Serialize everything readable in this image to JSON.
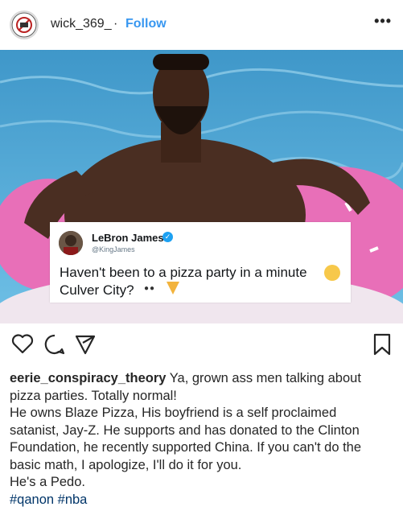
{
  "header": {
    "username": "wick_369_",
    "separator": "·",
    "follow_label": "Follow",
    "more_label": "•••"
  },
  "tweet": {
    "name": "LeBron James",
    "handle": "@KingJames",
    "line1": "Haven't been to a pizza party in a minute",
    "line2": "Culver City?"
  },
  "actions": {
    "like_icon": "heart-icon",
    "comment_icon": "comment-icon",
    "share_icon": "share-icon",
    "save_icon": "bookmark-icon"
  },
  "caption": {
    "user": "eerie_conspiracy_theory",
    "line1_rest": " Ya, grown ass men talking about",
    "line2": "pizza parties. Totally normal!",
    "line3": "He owns Blaze Pizza, His boyfriend is a self proclaimed",
    "line4": "satanist, Jay-Z. He supports and has donated to the Clinton",
    "line5": "Foundation, he recently supported China. If you can't do the",
    "line6": "basic math, I apologize, I'll do it for you.",
    "line7": "He's a Pedo.",
    "hashtags": "#qanon #nba"
  },
  "colors": {
    "link": "#3897f0",
    "pool": "#4fa9d6",
    "float": "#e86fb8"
  }
}
